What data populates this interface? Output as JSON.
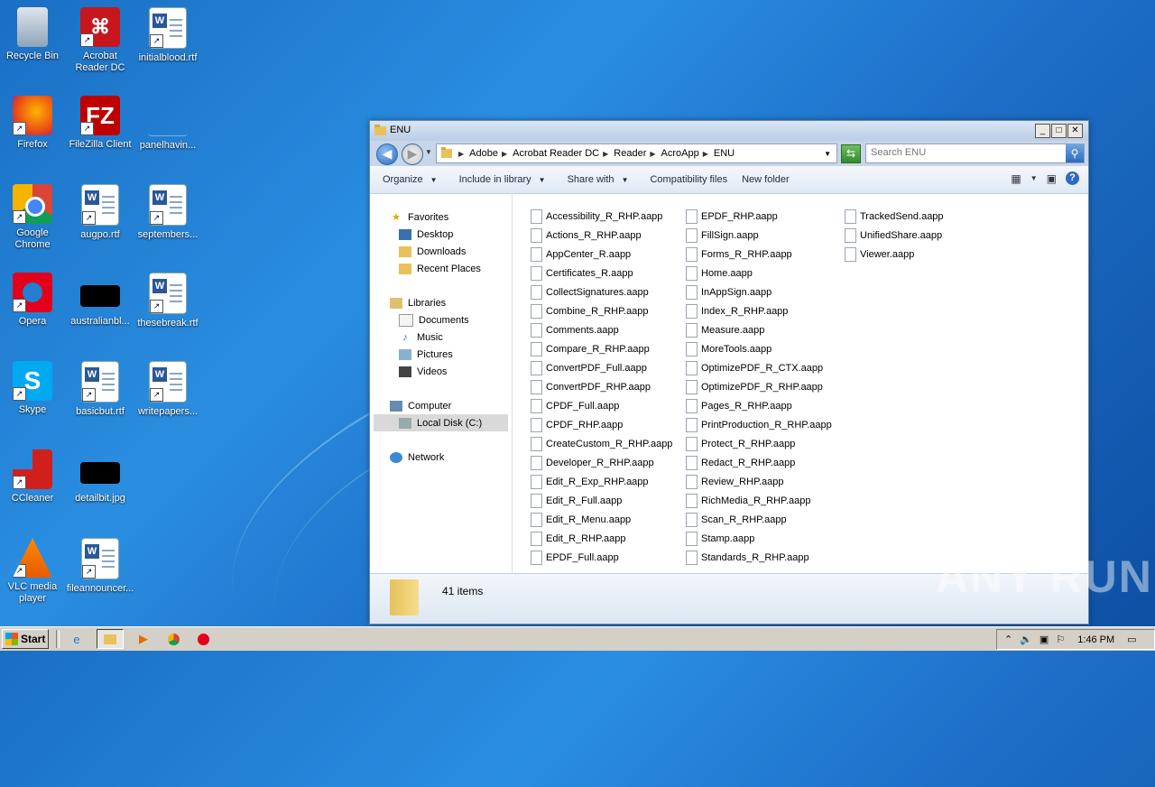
{
  "desktop": {
    "icons": [
      {
        "label": "Recycle Bin"
      },
      {
        "label": "Acrobat Reader DC"
      },
      {
        "label": "initialblood.rtf"
      },
      {
        "label": "Firefox"
      },
      {
        "label": "FileZilla Client"
      },
      {
        "label": "panelhavin..."
      },
      {
        "label": "Google Chrome"
      },
      {
        "label": "augpo.rtf"
      },
      {
        "label": "septembers..."
      },
      {
        "label": "Opera"
      },
      {
        "label": "australianbl..."
      },
      {
        "label": "thesebreak.rtf"
      },
      {
        "label": "Skype"
      },
      {
        "label": "basicbut.rtf"
      },
      {
        "label": "writepapers..."
      },
      {
        "label": "CCleaner"
      },
      {
        "label": "detailbit.jpg"
      },
      {
        "label": "VLC media player"
      },
      {
        "label": "fileannouncer..."
      }
    ]
  },
  "window": {
    "title": "ENU",
    "breadcrumbs": [
      "Adobe",
      "Acrobat Reader DC",
      "Reader",
      "AcroApp",
      "ENU"
    ],
    "search_placeholder": "Search ENU",
    "toolbar": {
      "organize": "Organize",
      "include": "Include in library",
      "share": "Share with",
      "compat": "Compatibility files",
      "newfolder": "New folder"
    },
    "nav": {
      "favorites": "Favorites",
      "desktop": "Desktop",
      "downloads": "Downloads",
      "recent": "Recent Places",
      "libraries": "Libraries",
      "documents": "Documents",
      "music": "Music",
      "pictures": "Pictures",
      "videos": "Videos",
      "computer": "Computer",
      "localdisk": "Local Disk (C:)",
      "network": "Network"
    },
    "files": [
      [
        "Accessibility_R_RHP.aapp",
        "Actions_R_RHP.aapp",
        "AppCenter_R.aapp",
        "Certificates_R.aapp",
        "CollectSignatures.aapp",
        "Combine_R_RHP.aapp",
        "Comments.aapp",
        "Compare_R_RHP.aapp",
        "ConvertPDF_Full.aapp",
        "ConvertPDF_RHP.aapp",
        "CPDF_Full.aapp",
        "CPDF_RHP.aapp",
        "CreateCustom_R_RHP.aapp",
        "Developer_R_RHP.aapp",
        "Edit_R_Exp_RHP.aapp",
        "Edit_R_Full.aapp",
        "Edit_R_Menu.aapp",
        "Edit_R_RHP.aapp",
        "EPDF_Full.aapp"
      ],
      [
        "EPDF_RHP.aapp",
        "FillSign.aapp",
        "Forms_R_RHP.aapp",
        "Home.aapp",
        "InAppSign.aapp",
        "Index_R_RHP.aapp",
        "Measure.aapp",
        "MoreTools.aapp",
        "OptimizePDF_R_CTX.aapp",
        "OptimizePDF_R_RHP.aapp",
        "Pages_R_RHP.aapp",
        "PrintProduction_R_RHP.aapp",
        "Protect_R_RHP.aapp",
        "Redact_R_RHP.aapp",
        "Review_RHP.aapp",
        "RichMedia_R_RHP.aapp",
        "Scan_R_RHP.aapp",
        "Stamp.aapp",
        "Standards_R_RHP.aapp"
      ],
      [
        "TrackedSend.aapp",
        "UnifiedShare.aapp",
        "Viewer.aapp"
      ]
    ],
    "status": "41 items"
  },
  "taskbar": {
    "start": "Start",
    "clock": "1:46 PM"
  },
  "watermark": "ANY RUN"
}
